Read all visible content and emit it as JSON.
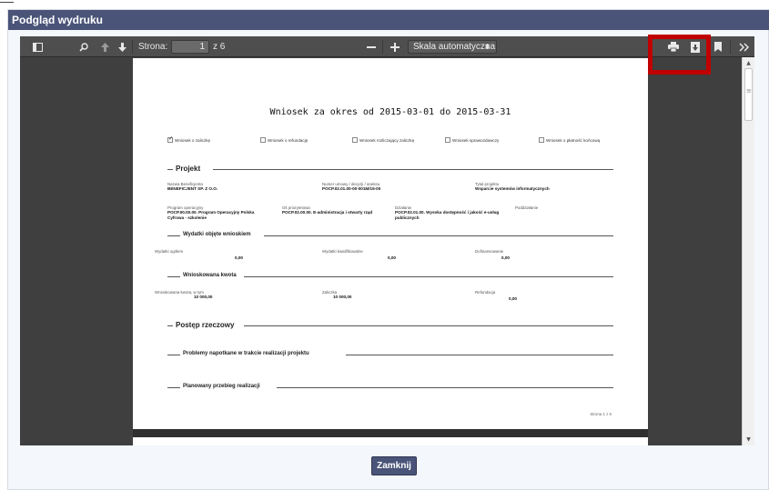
{
  "dialog": {
    "title": "Podgląd wydruku",
    "close_label": "Zamknij"
  },
  "toolbar": {
    "page_label": "Strona:",
    "page_value": "1",
    "page_total": "z 6",
    "scale_value": "Skala automatyczna",
    "icons": [
      "sidebar-toggle-icon",
      "search-icon",
      "previous-page-icon",
      "next-page-icon",
      "zoom-out-icon",
      "zoom-in-icon",
      "print-icon",
      "download-icon",
      "bookmark-icon",
      "tools-menu-icon"
    ]
  },
  "document": {
    "title": "Wniosek za okres od 2015-03-01 do 2015-03-31",
    "checkboxes": [
      {
        "label": "Wniosek o zaliczkę",
        "checked": true
      },
      {
        "label": "Wniosek o refundację",
        "checked": false
      },
      {
        "label": "Wniosek rozliczający zaliczkę",
        "checked": false
      },
      {
        "label": "Wniosek sprawozdawczy",
        "checked": false
      },
      {
        "label": "Wniosek o płatność końcową",
        "checked": false
      }
    ],
    "projekt": {
      "heading": "Projekt",
      "f1_label": "Nazwa Beneficjenta",
      "f1_value": "BENEFICJENT SP. Z O.O.",
      "f2_label": "Numer umowy / decyzji / aneksu",
      "f2_value": "POCP.02.01.00-00-001M/15-00",
      "f3_label": "Tytuł projektu",
      "f3_value": "Wsparcie systemów informatycznych",
      "f4_label": "Program operacyjny",
      "f4_value": "POCP.00.00.00. Program Operacyjny Polska Cyfrowa - szkolenie",
      "f5_label": "Oś priorytetowa",
      "f5_value": "POCP.02.00.00. E-administracja i otwarty rząd",
      "f6_label": "Działanie",
      "f6_value": "POCP.02.01.00. Wysoka dostępność i jakość e-usług publicznych",
      "f7_label": "Poddziałanie"
    },
    "wydatki": {
      "heading": "Wydatki objęte wnioskiem",
      "l1": "Wydatki ogółem",
      "v1": "0,00",
      "l2": "Wydatki kwalifikowalne",
      "v2": "0,00",
      "l3": "Dofinansowanie",
      "v3": "0,00"
    },
    "kwota": {
      "heading": "Wnioskowana kwota",
      "l1": "Wnioskowana kwota, w tym",
      "v1": "10 000,00",
      "l2": "Zaliczka",
      "v2": "10 000,00",
      "l3": "Refundacja",
      "v3": "0,00"
    },
    "postep_heading": "Postęp rzeczowy",
    "problemy_heading": "Problemy napotkane w trakcie realizacji projektu",
    "planowany_heading": "Planowany przebieg realizacji",
    "page_number": "Strona 1 z 6"
  },
  "colors": {
    "header": "#4a5478",
    "highlight": "#c00000",
    "viewer_bg": "#3f3f3f"
  }
}
